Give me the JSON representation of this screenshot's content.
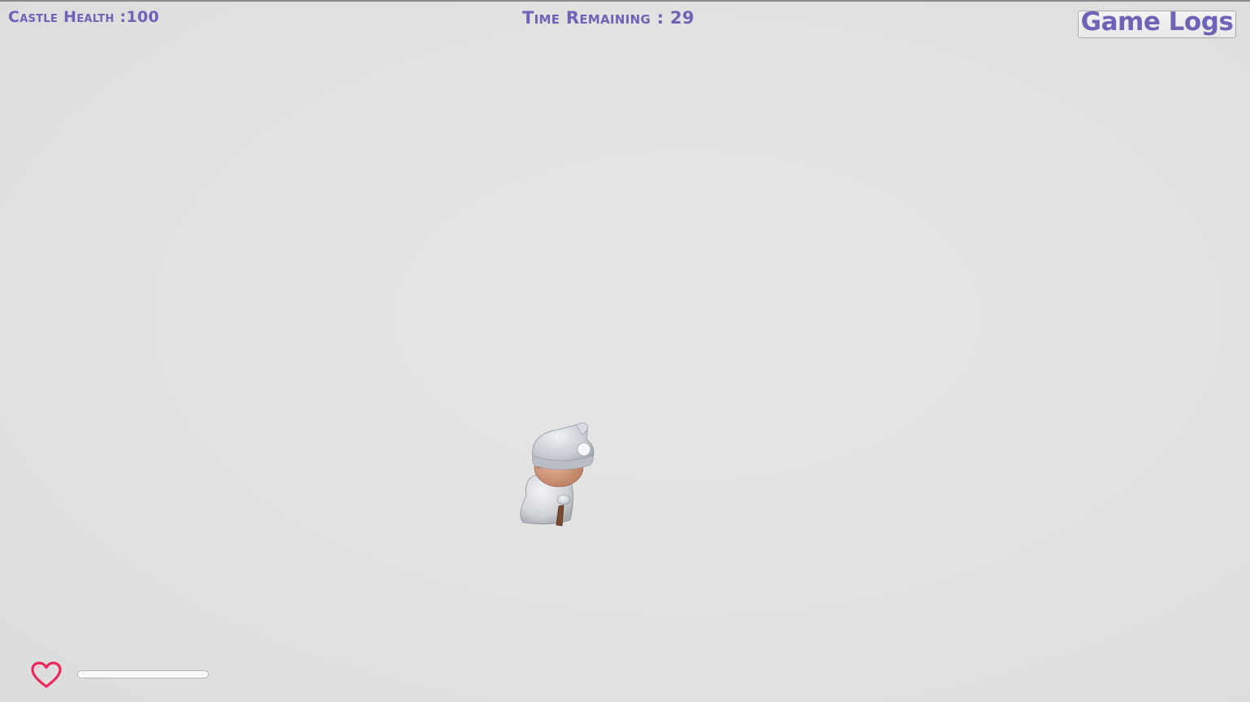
{
  "hud": {
    "castle_health": "Castle Health :100",
    "time_remaining": "Time Remaining : 29"
  },
  "game_logs_button": {
    "label": "Game Logs"
  },
  "player": {
    "health_fraction": 1.0
  },
  "icons": {
    "heart": "heart-icon",
    "character": "gnome-character"
  },
  "colors": {
    "hud_text": "#6d63b7",
    "heart": "#e8295c",
    "background": "#e1e1e1"
  }
}
